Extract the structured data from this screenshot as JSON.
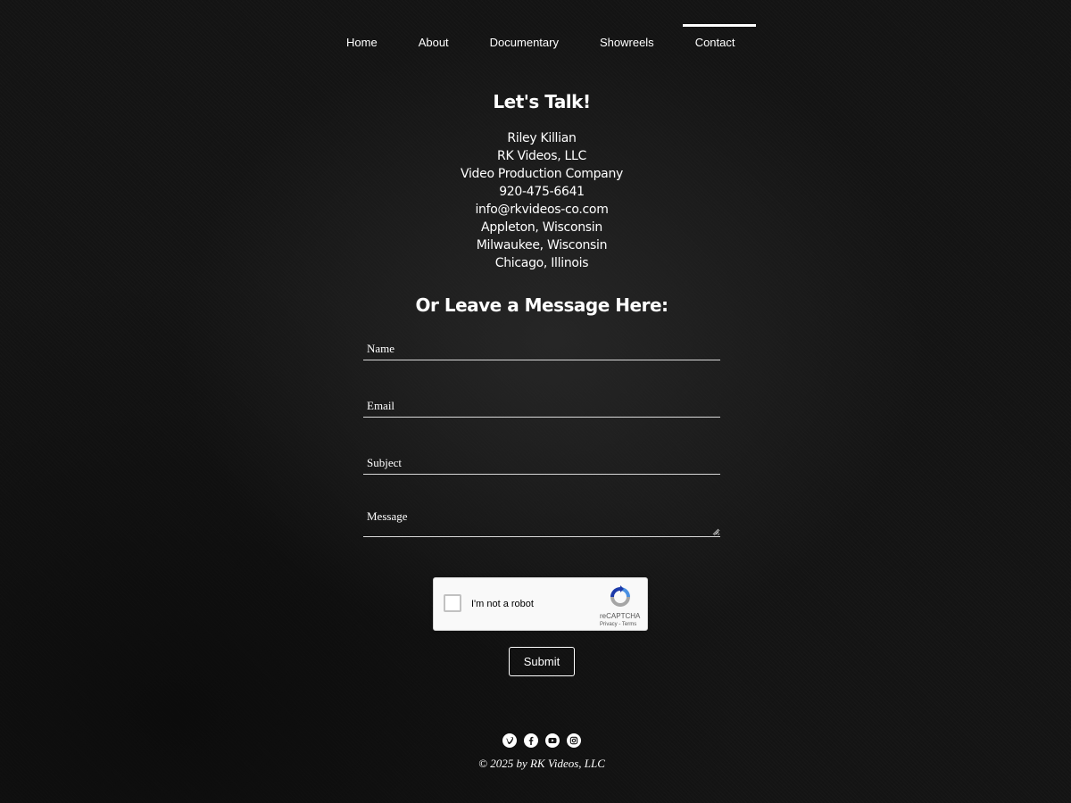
{
  "nav": {
    "items": [
      {
        "label": "Home",
        "active": false
      },
      {
        "label": "About",
        "active": false
      },
      {
        "label": "Documentary",
        "active": false
      },
      {
        "label": "Showreels",
        "active": false
      },
      {
        "label": "Contact",
        "active": true
      }
    ]
  },
  "contact": {
    "heading": "Let's Talk!",
    "lines": [
      "Riley Killian",
      "RK Videos, LLC",
      "Video Production Company",
      "920-475-6641",
      "info@rkvideos-co.com",
      "Appleton, Wisconsin",
      "Milwaukee, Wisconsin",
      "Chicago, Illinois"
    ]
  },
  "form": {
    "heading": "Or Leave a Message Here:",
    "name_placeholder": "Name",
    "email_placeholder": "Email",
    "subject_placeholder": "Subject",
    "message_placeholder": "Message",
    "submit_label": "Submit"
  },
  "recaptcha": {
    "label": "I'm not a robot",
    "brand": "reCAPTCHA",
    "terms": "Privacy - Terms"
  },
  "social": {
    "icons": [
      "vimeo-icon",
      "facebook-icon",
      "youtube-icon",
      "instagram-icon"
    ]
  },
  "footer": {
    "copyright": "© 2025 by RK Videos, LLC"
  },
  "colors": {
    "background": "#141414",
    "text": "#ffffff",
    "underline": "#d9d9d9",
    "recaptcha_blue": "#4a90e2",
    "recaptcha_gray": "#a6a6a6"
  }
}
